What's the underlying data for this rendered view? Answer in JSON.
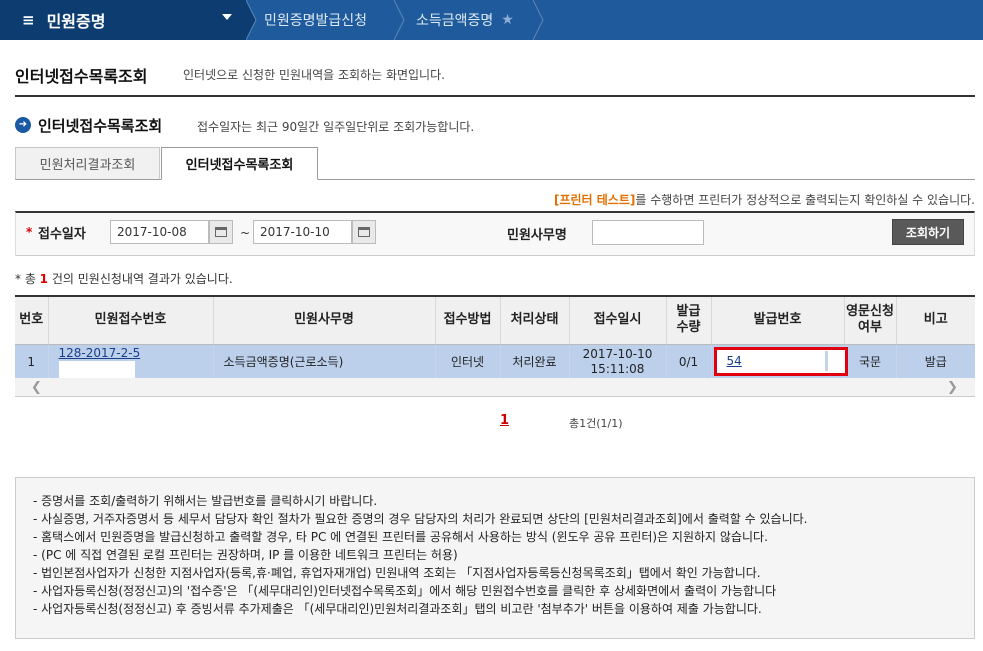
{
  "topbar": {
    "menu_icon": "≡",
    "menu_title": "민원증명",
    "crumb1": "민원증명발급신청",
    "crumb2": "소득금액증명",
    "star_icon": "★"
  },
  "page": {
    "title": "인터넷접수목록조회",
    "description": "인터넷으로 신청한 민원내역을 조회하는 화면입니다."
  },
  "section": {
    "title": "인터넷접수목록조회",
    "description": "접수일자는 최근 90일간 일주일단위로 조회가능합니다."
  },
  "tabs": {
    "tab1": "민원처리결과조회",
    "tab2": "인터넷접수목록조회"
  },
  "notice": {
    "highlight": "[프린터 테스트]",
    "rest": "를 수행하면 프린터가 정상적으로 출력되는지 확인하실 수 있습니다."
  },
  "search": {
    "required_mark": "*",
    "date_label": "접수일자",
    "date_from": "2017-10-08",
    "date_to": "2017-10-10",
    "tilde": "~",
    "name_label": "민원사무명",
    "name_value": "",
    "button": "조회하기"
  },
  "result": {
    "prefix": "* 총 ",
    "count": "1",
    "suffix": " 건의 민원신청내역 결과가 있습니다."
  },
  "table": {
    "headers": {
      "no": "번호",
      "receipt_no": "민원접수번호",
      "name": "민원사무명",
      "method": "접수방법",
      "status": "처리상태",
      "date": "접수일시",
      "qty_line1": "발급",
      "qty_line2": "수량",
      "issue_no": "발급번호",
      "eng_line1": "영문신청",
      "eng_line2": "여부",
      "remark": "비고"
    },
    "rows": [
      {
        "no": "1",
        "receipt_no": "128-2017-2-5",
        "name": "소득금액증명(근로소득)",
        "method": "인터넷",
        "status": "처리완료",
        "date_line1": "2017-10-10",
        "date_line2": "15:11:08",
        "qty": "0/1",
        "issue_no": "54",
        "eng": "국문",
        "remark": "발급"
      }
    ]
  },
  "pager": {
    "current": "1",
    "total": "총1건(1/1)"
  },
  "notes": [
    "- 증명서를 조회/출력하기 위해서는 발급번호를 클릭하시기 바랍니다.",
    "- 사실증명, 거주자증명서 등 세무서 담당자 확인 절차가 필요한 증명의 경우 담당자의 처리가 완료되면 상단의 [민원처리결과조회]에서 출력할 수 있습니다.",
    "- 홈택스에서 민원증명을 발급신청하고 출력할 경우, 타 PC 에 연결된 프린터를 공유해서 사용하는 방식 (윈도우 공유 프린터)은 지원하지 않습니다.",
    "- (PC 에 직접 연결된 로컬 프린터는 권장하며, IP 를 이용한 네트워크 프린터는 허용)",
    "- 법인본점사업자가 신청한 지점사업자(등록,휴·폐업, 휴업자재개업) 민원내역 조회는 「지점사업자등록등신청목록조회」탭에서 확인 가능합니다.",
    "- 사업자등록신청(정정신고)의 '접수증'은 「(세무대리인)인터넷접수목록조회」에서 해당 민원접수번호를 클릭한 후 상세화면에서 출력이 가능합니다",
    "- 사업자등록신청(정정신고) 후 증빙서류 추가제출은 「(세무대리인)민원처리결과조회」탭의 비고란 '첨부추가' 버튼을 이용하여 제출 가능합니다."
  ]
}
